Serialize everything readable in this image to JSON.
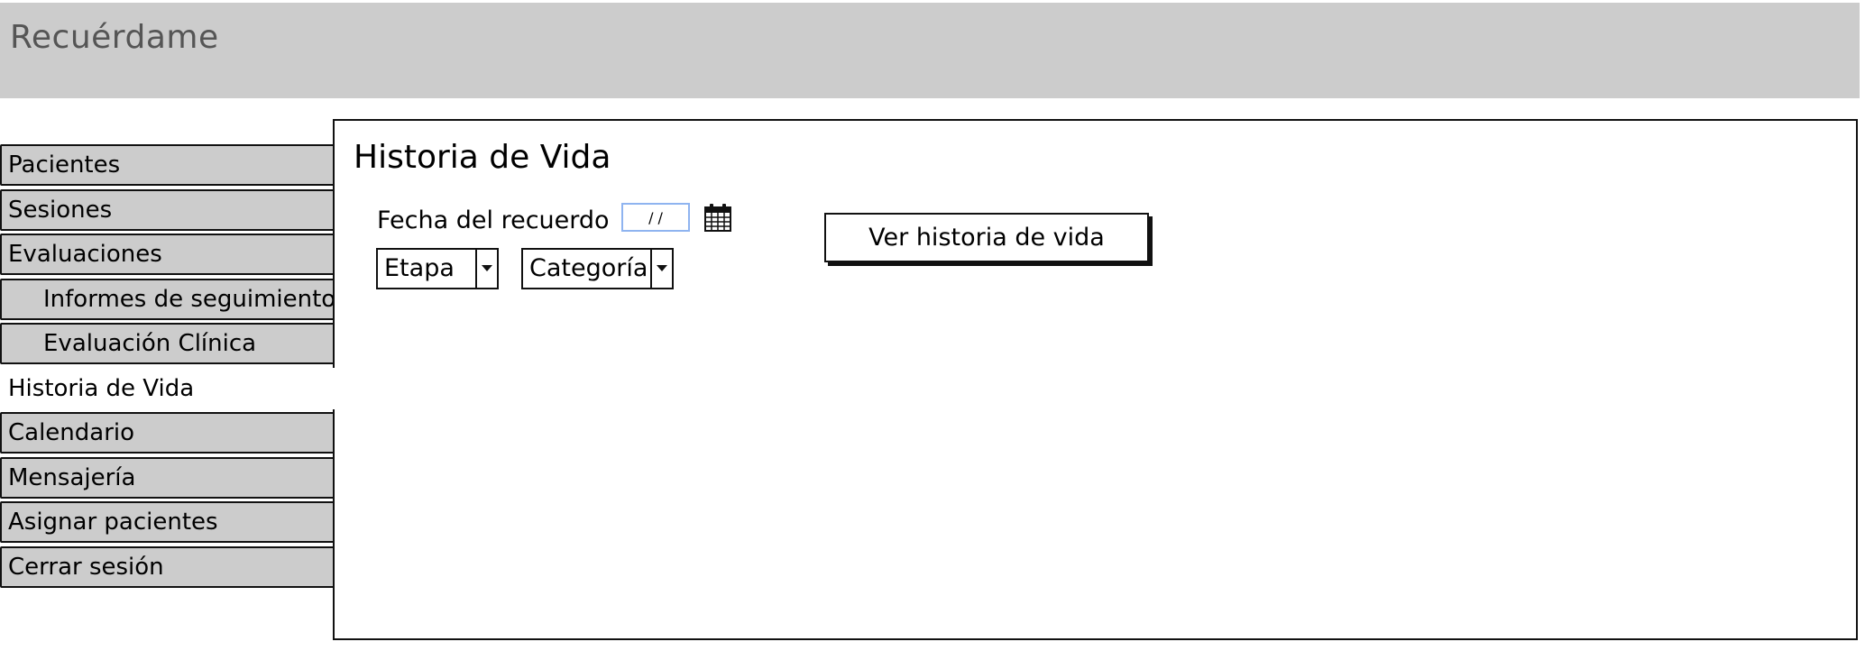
{
  "app": {
    "title": "Recuérdame"
  },
  "sidebar": {
    "items": [
      {
        "label": "Pacientes"
      },
      {
        "label": "Sesiones"
      },
      {
        "label": "Evaluaciones"
      },
      {
        "label": "Informes de seguimiento"
      },
      {
        "label": "Evaluación Clínica"
      },
      {
        "label": "Historia de Vida"
      },
      {
        "label": "Calendario"
      },
      {
        "label": "Mensajería"
      },
      {
        "label": "Asignar pacientes"
      },
      {
        "label": "Cerrar sesión"
      }
    ],
    "active_item": "Historia de Vida"
  },
  "main": {
    "title": "Historia de Vida",
    "date_field": {
      "label": "Fecha del recuerdo",
      "value": "/ /",
      "icon": "calendar-icon"
    },
    "stage_select": {
      "value": "Etapa"
    },
    "category_select": {
      "value": "Categoría"
    },
    "view_button": {
      "label": "Ver historia de vida"
    }
  },
  "colors": {
    "header_bg": "#cccccc",
    "nav_bg": "#cccccc",
    "title_text": "#555555",
    "date_input_border": "#8fb4f0",
    "border": "#111111"
  }
}
